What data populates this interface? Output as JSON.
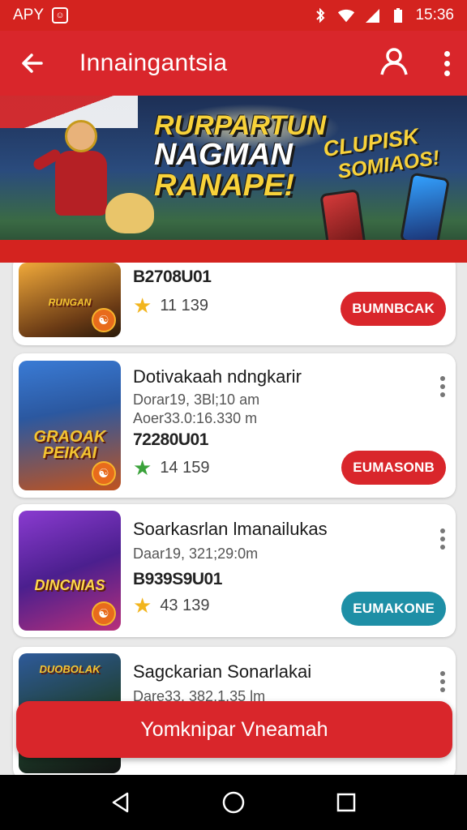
{
  "status_bar": {
    "carrier": "APY",
    "time": "15:36",
    "icons": [
      "app-badge-icon",
      "bluetooth-icon",
      "wifi-icon",
      "signal-icon",
      "battery-icon"
    ]
  },
  "app_bar": {
    "title": "Innaingantsia",
    "icons": [
      "back-arrow-icon",
      "account-icon",
      "more-vert-icon"
    ]
  },
  "banner": {
    "title_line1": "RURPARTUN",
    "title_line2": "NAGMAN",
    "title_line3": "RANAPE!",
    "sub_line1": "CLUPISK",
    "sub_line2": "SOMIAOS!"
  },
  "games": [
    {
      "thumb_text": "RUNGAN",
      "code": "B2708U01",
      "rating": "11 139",
      "star": "gold",
      "button": "BUMNBCAK",
      "button_color": "#d9262b"
    },
    {
      "thumb_text": "GRAOAK PEIKAI",
      "name": "Dotivakaah ndngkarir",
      "meta1": "Dorar19, 3Bl;10 am",
      "meta2": "Aoer33.0:16.330 m",
      "code": "72280U01",
      "rating": "14 159",
      "star": "green",
      "button": "EUMASONB",
      "button_color": "#d9262b"
    },
    {
      "thumb_text": "DINCNIAS",
      "name": "Soarkasrlan lmanailukas",
      "meta1": "Daar19, 321;29:0m",
      "code": "B939S9U01",
      "rating": "43 139",
      "star": "gold",
      "button": "EUMAKONE",
      "button_color": "#1e8fa6"
    },
    {
      "thumb_text": "DUOBOLAK",
      "name": "Sagckarian Sonarlakai",
      "meta1": "Dare33. 382.1.35 lm"
    }
  ],
  "fab": {
    "label": "Yomknipar Vneamah"
  },
  "nav_bar": {
    "icons": [
      "nav-back-icon",
      "nav-home-icon",
      "nav-recents-icon"
    ]
  }
}
